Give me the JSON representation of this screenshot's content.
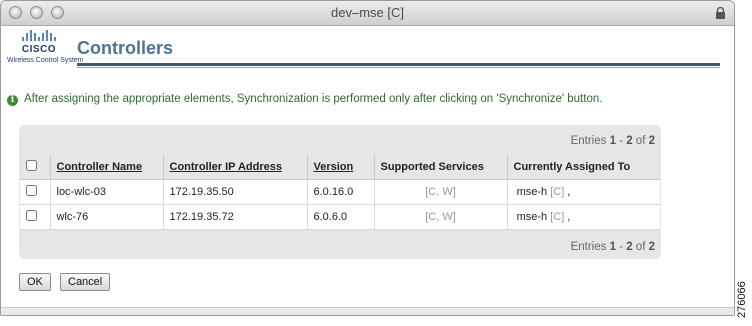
{
  "window": {
    "title": "dev–mse   [C]"
  },
  "brand": {
    "name": "CISCO",
    "subtitle": "Wireless Control System"
  },
  "header": {
    "title": "Controllers"
  },
  "info": {
    "message": "After assigning the appropriate elements, Synchronization is performed only after clicking on 'Synchronize' button."
  },
  "pager": {
    "prefix": "Entries ",
    "first": "1",
    "sep": " - ",
    "last": "2",
    "of": " of ",
    "total": "2"
  },
  "table": {
    "columns": [
      "Controller Name",
      "Controller IP Address",
      "Version",
      "Supported Services",
      "Currently Assigned To"
    ],
    "rows": [
      {
        "name": "loc-wlc-03",
        "ip": "172.19.35.50",
        "version": "6.0.16.0",
        "services": "[C, W]",
        "assigned": "mse-h",
        "assigned_tag": "[C]",
        "assigned_suffix": " ,"
      },
      {
        "name": "wlc-76",
        "ip": "172.19.35.72",
        "version": "6.0.6.0",
        "services": "[C, W]",
        "assigned": "mse-h",
        "assigned_tag": "[C]",
        "assigned_suffix": " ,"
      }
    ]
  },
  "buttons": {
    "ok": "OK",
    "cancel": "Cancel"
  },
  "figure_id": "276066",
  "colors": {
    "title": "#4f7391",
    "info": "#2f6d2c",
    "panel": "#e6e6e6",
    "rule": "#3f5771"
  }
}
